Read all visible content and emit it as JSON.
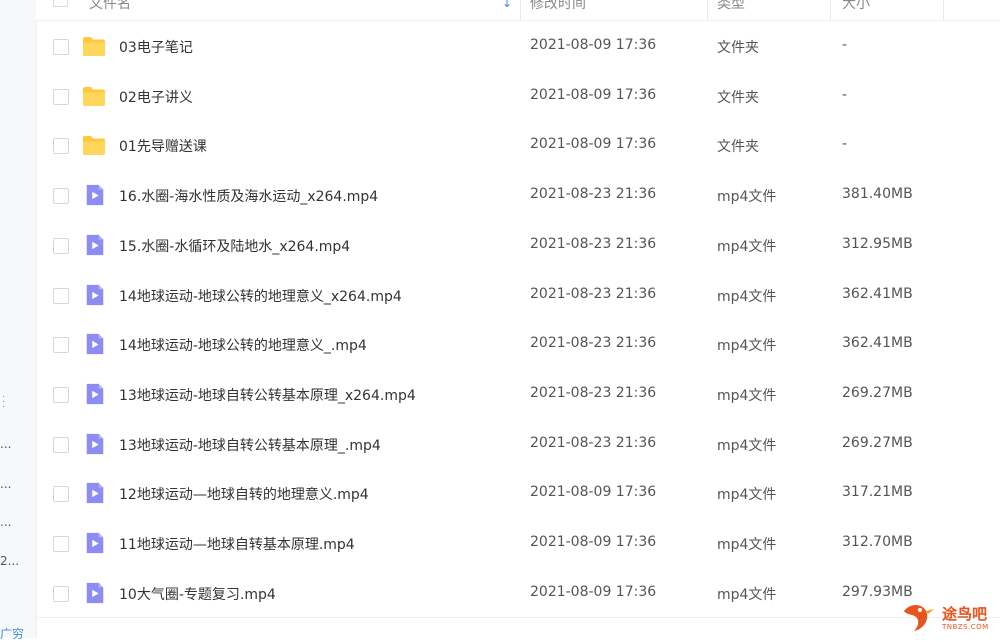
{
  "header": {
    "name_label": "文件名",
    "mtime_label": "修改时间",
    "type_label": "类型",
    "size_label": "大小"
  },
  "sidebar_fragments": [
    "...",
    "...",
    "...",
    "2...",
    "广穷"
  ],
  "files": [
    {
      "name": "03电子笔记",
      "mtime": "2021-08-09 17:36",
      "type": "文件夹",
      "size": "-",
      "kind": "folder"
    },
    {
      "name": "02电子讲义",
      "mtime": "2021-08-09 17:36",
      "type": "文件夹",
      "size": "-",
      "kind": "folder"
    },
    {
      "name": "01先导赠送课",
      "mtime": "2021-08-09 17:36",
      "type": "文件夹",
      "size": "-",
      "kind": "folder"
    },
    {
      "name": "16.水圈-海水性质及海水运动_x264.mp4",
      "mtime": "2021-08-23 21:36",
      "type": "mp4文件",
      "size": "381.40MB",
      "kind": "video"
    },
    {
      "name": "15.水圈-水循环及陆地水_x264.mp4",
      "mtime": "2021-08-23 21:36",
      "type": "mp4文件",
      "size": "312.95MB",
      "kind": "video"
    },
    {
      "name": "14地球运动-地球公转的地理意义_x264.mp4",
      "mtime": "2021-08-23 21:36",
      "type": "mp4文件",
      "size": "362.41MB",
      "kind": "video"
    },
    {
      "name": "14地球运动-地球公转的地理意义_.mp4",
      "mtime": "2021-08-23 21:36",
      "type": "mp4文件",
      "size": "362.41MB",
      "kind": "video"
    },
    {
      "name": "13地球运动-地球自转公转基本原理_x264.mp4",
      "mtime": "2021-08-23 21:36",
      "type": "mp4文件",
      "size": "269.27MB",
      "kind": "video"
    },
    {
      "name": "13地球运动-地球自转公转基本原理_.mp4",
      "mtime": "2021-08-23 21:36",
      "type": "mp4文件",
      "size": "269.27MB",
      "kind": "video"
    },
    {
      "name": "12地球运动—地球自转的地理意义.mp4",
      "mtime": "2021-08-09 17:36",
      "type": "mp4文件",
      "size": "317.21MB",
      "kind": "video"
    },
    {
      "name": "11地球运动—地球自转基本原理.mp4",
      "mtime": "2021-08-09 17:36",
      "type": "mp4文件",
      "size": "312.70MB",
      "kind": "video"
    },
    {
      "name": "10大气圈-专题复习.mp4",
      "mtime": "2021-08-09 17:36",
      "type": "mp4文件",
      "size": "297.93MB",
      "kind": "video"
    }
  ],
  "watermark": {
    "text": "途鸟吧",
    "sub": "TNBZS.COM"
  },
  "colors": {
    "folder": "#ffc83d",
    "video": "#8c8cf2",
    "accent": "#3a8ee6",
    "watermark": "#e8541e"
  }
}
